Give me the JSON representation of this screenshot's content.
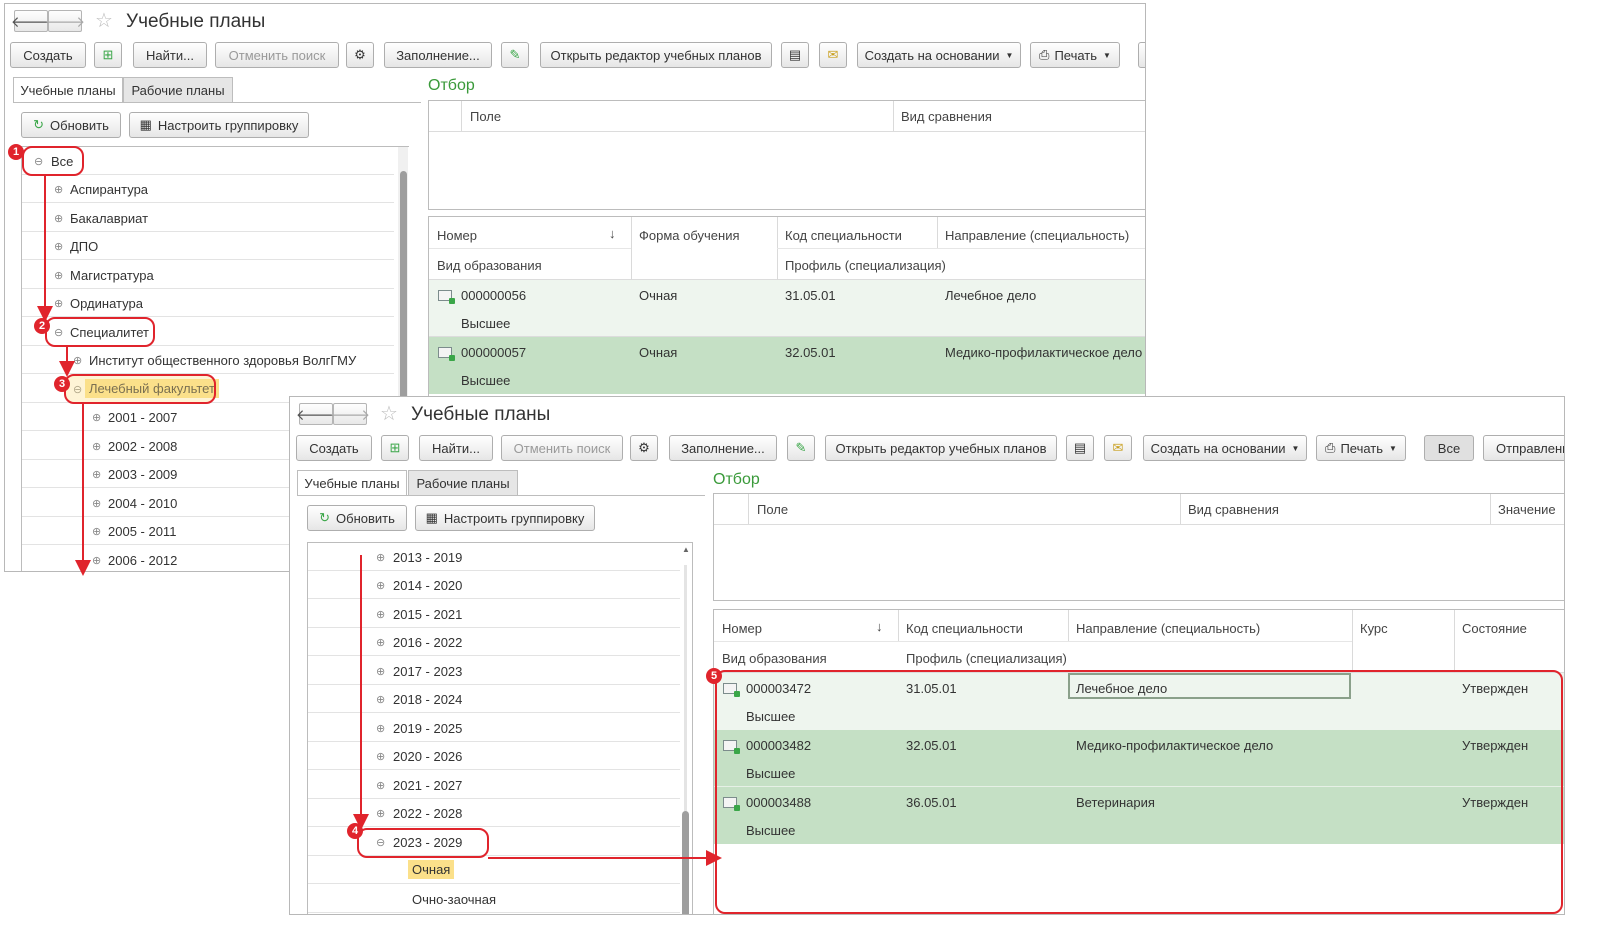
{
  "back": {
    "title": "Учебные планы",
    "toolbar": {
      "create": "Создать",
      "find": "Найти...",
      "cancel_search": "Отменить поиск",
      "fill": "Заполнение...",
      "open_editor": "Открыть редактор учебных планов",
      "create_based": "Создать на основании",
      "print": "Печать"
    },
    "tabs": [
      "Учебные планы",
      "Рабочие планы"
    ],
    "refresh": "Обновить",
    "grouping": "Настроить группировку",
    "tree": {
      "all": "Все",
      "items": [
        "Аспирантура",
        "Бакалавриат",
        "ДПО",
        "Магистратура",
        "Ординатура"
      ],
      "specialitet": "Специалитет",
      "institute": "Институт общественного здоровья ВолгГМУ",
      "faculty": "Лечебный факультет",
      "years": [
        "2001 - 2007",
        "2002 - 2008",
        "2003 - 2009",
        "2004 - 2010",
        "2005 - 2011",
        "2006 - 2012"
      ]
    },
    "filter": {
      "title": "Отбор",
      "field": "Поле",
      "compare": "Вид сравнения"
    },
    "table": {
      "headers": {
        "number": "Номер",
        "form": "Форма обучения",
        "code": "Код специальности",
        "direction": "Направление (специальность)",
        "edu_type": "Вид образования",
        "profile": "Профиль (специализация)",
        "sort_arrow": "↓"
      },
      "rows": [
        {
          "number": "000000056",
          "form": "Очная",
          "code": "31.05.01",
          "direction": "Лечебное дело",
          "edu": "Высшее"
        },
        {
          "number": "000000057",
          "form": "Очная",
          "code": "32.05.01",
          "direction": "Медико-профилактическое дело",
          "edu": "Высшее"
        }
      ]
    }
  },
  "front": {
    "title": "Учебные планы",
    "toolbar": {
      "create": "Создать",
      "find": "Найти...",
      "cancel_search": "Отменить поиск",
      "fill": "Заполнение...",
      "open_editor": "Открыть редактор учебных планов",
      "create_based": "Создать на основании",
      "print": "Печать",
      "all": "Все",
      "send": "Отправлени"
    },
    "tabs": [
      "Учебные планы",
      "Рабочие планы"
    ],
    "refresh": "Обновить",
    "grouping": "Настроить группировку",
    "years": [
      "2013 - 2019",
      "2014 - 2020",
      "2015 - 2021",
      "2016 - 2022",
      "2017 - 2023",
      "2018 - 2024",
      "2019 - 2025",
      "2020 - 2026",
      "2021 - 2027",
      "2022 - 2028",
      "2023 - 2029"
    ],
    "forms": [
      "Очная",
      "Очно-заочная"
    ],
    "filter": {
      "title": "Отбор",
      "field": "Поле",
      "compare": "Вид сравнения",
      "value": "Значение"
    },
    "table": {
      "headers": {
        "number": "Номер",
        "code": "Код специальности",
        "direction": "Направление (специальность)",
        "course": "Курс",
        "state": "Состояние",
        "edu_type": "Вид образования",
        "profile": "Профиль (специализация)",
        "sort_arrow": "↓"
      },
      "rows": [
        {
          "number": "000003472",
          "code": "31.05.01",
          "direction": "Лечебное дело",
          "state": "Утвержден",
          "edu": "Высшее"
        },
        {
          "number": "000003482",
          "code": "32.05.01",
          "direction": "Медико-профилактическое дело",
          "state": "Утвержден",
          "edu": "Высшее"
        },
        {
          "number": "000003488",
          "code": "36.05.01",
          "direction": "Ветеринария",
          "state": "Утвержден",
          "edu": "Высшее"
        }
      ]
    }
  },
  "markers": [
    "1",
    "2",
    "3",
    "4",
    "5"
  ],
  "colors": {
    "annotation": "#e0242c",
    "selected_row": "#c5e0c5",
    "highlight": "#fbe08a",
    "accent": "#3a9a3a"
  }
}
